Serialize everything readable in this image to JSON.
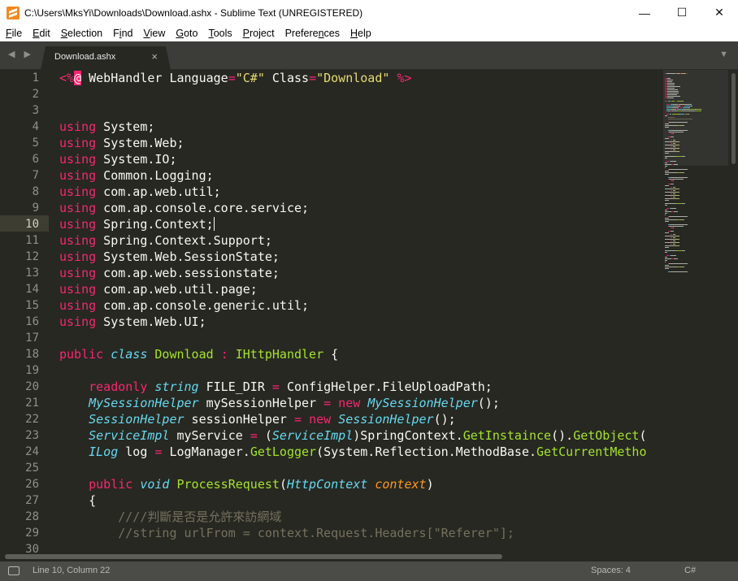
{
  "window": {
    "title": "C:\\Users\\MksYi\\Downloads\\Download.ashx - Sublime Text (UNREGISTERED)",
    "minimize": "—",
    "maximize": "☐",
    "close": "✕"
  },
  "menu": [
    {
      "pre": "",
      "acc": "F",
      "post": "ile"
    },
    {
      "pre": "",
      "acc": "E",
      "post": "dit"
    },
    {
      "pre": "",
      "acc": "S",
      "post": "election"
    },
    {
      "pre": "F",
      "acc": "i",
      "post": "nd"
    },
    {
      "pre": "",
      "acc": "V",
      "post": "iew"
    },
    {
      "pre": "",
      "acc": "G",
      "post": "oto"
    },
    {
      "pre": "",
      "acc": "T",
      "post": "ools"
    },
    {
      "pre": "",
      "acc": "P",
      "post": "roject"
    },
    {
      "pre": "Prefere",
      "acc": "n",
      "post": "ces"
    },
    {
      "pre": "",
      "acc": "H",
      "post": "elp"
    }
  ],
  "tab": {
    "label": "Download.ashx",
    "close": "×",
    "nav_arrows": "◀ ▶",
    "dropdown": "▼"
  },
  "editor": {
    "active_line": 10,
    "line_numbers": [
      "1",
      "2",
      "3",
      "4",
      "5",
      "6",
      "7",
      "8",
      "9",
      "10",
      "11",
      "12",
      "13",
      "14",
      "15",
      "16",
      "17",
      "18",
      "19",
      "20",
      "21",
      "22",
      "23",
      "24",
      "25",
      "26",
      "27",
      "28",
      "29",
      "30"
    ],
    "lines": [
      [
        [
          "kw",
          "<%"
        ],
        [
          "at",
          "@"
        ],
        [
          "pl",
          " WebHandler Language"
        ],
        [
          "kw",
          "="
        ],
        [
          "str",
          "\"C#\""
        ],
        [
          "pl",
          " Class"
        ],
        [
          "kw",
          "="
        ],
        [
          "str",
          "\"Download\""
        ],
        [
          "pl",
          " "
        ],
        [
          "kw",
          "%>"
        ]
      ],
      [],
      [],
      [
        [
          "kw",
          "using"
        ],
        [
          "pl",
          " System;"
        ]
      ],
      [
        [
          "kw",
          "using"
        ],
        [
          "pl",
          " System.Web;"
        ]
      ],
      [
        [
          "kw",
          "using"
        ],
        [
          "pl",
          " System.IO;"
        ]
      ],
      [
        [
          "kw",
          "using"
        ],
        [
          "pl",
          " Common.Logging;"
        ]
      ],
      [
        [
          "kw",
          "using"
        ],
        [
          "pl",
          " com.ap.web.util;"
        ]
      ],
      [
        [
          "kw",
          "using"
        ],
        [
          "pl",
          " com.ap.console.core.service;"
        ]
      ],
      [
        [
          "kw",
          "using"
        ],
        [
          "pl",
          " Spring.Context;"
        ]
      ],
      [
        [
          "kw",
          "using"
        ],
        [
          "pl",
          " Spring.Context.Support;"
        ]
      ],
      [
        [
          "kw",
          "using"
        ],
        [
          "pl",
          " System.Web.SessionState;"
        ]
      ],
      [
        [
          "kw",
          "using"
        ],
        [
          "pl",
          " com.ap.web.sessionstate;"
        ]
      ],
      [
        [
          "kw",
          "using"
        ],
        [
          "pl",
          " com.ap.web.util.page;"
        ]
      ],
      [
        [
          "kw",
          "using"
        ],
        [
          "pl",
          " com.ap.console.generic.util;"
        ]
      ],
      [
        [
          "kw",
          "using"
        ],
        [
          "pl",
          " System.Web.UI;"
        ]
      ],
      [],
      [
        [
          "kw",
          "public"
        ],
        [
          "pl",
          " "
        ],
        [
          "st",
          "class"
        ],
        [
          "pl",
          " "
        ],
        [
          "cl",
          "Download"
        ],
        [
          "pl",
          " "
        ],
        [
          "kw",
          ":"
        ],
        [
          "pl",
          " "
        ],
        [
          "cl",
          "IHttpHandler"
        ],
        [
          "pl",
          " {"
        ]
      ],
      [],
      [
        [
          "pl",
          "    "
        ],
        [
          "kw",
          "readonly"
        ],
        [
          "pl",
          " "
        ],
        [
          "st",
          "string"
        ],
        [
          "pl",
          " FILE_DIR "
        ],
        [
          "kw",
          "="
        ],
        [
          "pl",
          " ConfigHelper.FileUploadPath;"
        ]
      ],
      [
        [
          "pl",
          "    "
        ],
        [
          "st",
          "MySessionHelper"
        ],
        [
          "pl",
          " mySessionHelper "
        ],
        [
          "kw",
          "="
        ],
        [
          "pl",
          " "
        ],
        [
          "kw",
          "new"
        ],
        [
          "pl",
          " "
        ],
        [
          "st",
          "MySessionHelper"
        ],
        [
          "pl",
          "();"
        ]
      ],
      [
        [
          "pl",
          "    "
        ],
        [
          "st",
          "SessionHelper"
        ],
        [
          "pl",
          " sessionHelper "
        ],
        [
          "kw",
          "="
        ],
        [
          "pl",
          " "
        ],
        [
          "kw",
          "new"
        ],
        [
          "pl",
          " "
        ],
        [
          "st",
          "SessionHelper"
        ],
        [
          "pl",
          "();"
        ]
      ],
      [
        [
          "pl",
          "    "
        ],
        [
          "st",
          "ServiceImpl"
        ],
        [
          "pl",
          " myService "
        ],
        [
          "kw",
          "="
        ],
        [
          "pl",
          " ("
        ],
        [
          "st",
          "ServiceImpl"
        ],
        [
          "pl",
          ")SpringContext."
        ],
        [
          "fn",
          "GetInstaince"
        ],
        [
          "pl",
          "()."
        ],
        [
          "fn",
          "GetObject"
        ],
        [
          "pl",
          "("
        ]
      ],
      [
        [
          "pl",
          "    "
        ],
        [
          "st",
          "ILog"
        ],
        [
          "pl",
          " log "
        ],
        [
          "kw",
          "="
        ],
        [
          "pl",
          " LogManager."
        ],
        [
          "fn",
          "GetLogger"
        ],
        [
          "pl",
          "(System.Reflection.MethodBase."
        ],
        [
          "fn",
          "GetCurrentMetho"
        ]
      ],
      [],
      [
        [
          "pl",
          "    "
        ],
        [
          "kw",
          "public"
        ],
        [
          "pl",
          " "
        ],
        [
          "st",
          "void"
        ],
        [
          "pl",
          " "
        ],
        [
          "fn",
          "ProcessRequest"
        ],
        [
          "pl",
          "("
        ],
        [
          "st",
          "HttpContext"
        ],
        [
          "pl",
          " "
        ],
        [
          "par",
          "context"
        ],
        [
          "pl",
          ")"
        ]
      ],
      [
        [
          "pl",
          "    {"
        ]
      ],
      [
        [
          "pl",
          "        "
        ],
        [
          "cm",
          "////判斷是否是允許來訪網域"
        ]
      ],
      [
        [
          "pl",
          "        "
        ],
        [
          "cm",
          "//string urlFrom = context.Request.Headers[\"Referer\"];"
        ]
      ],
      []
    ]
  },
  "status": {
    "position": "Line 10, Column 22",
    "spaces": "Spaces: 4",
    "syntax": "C#"
  }
}
